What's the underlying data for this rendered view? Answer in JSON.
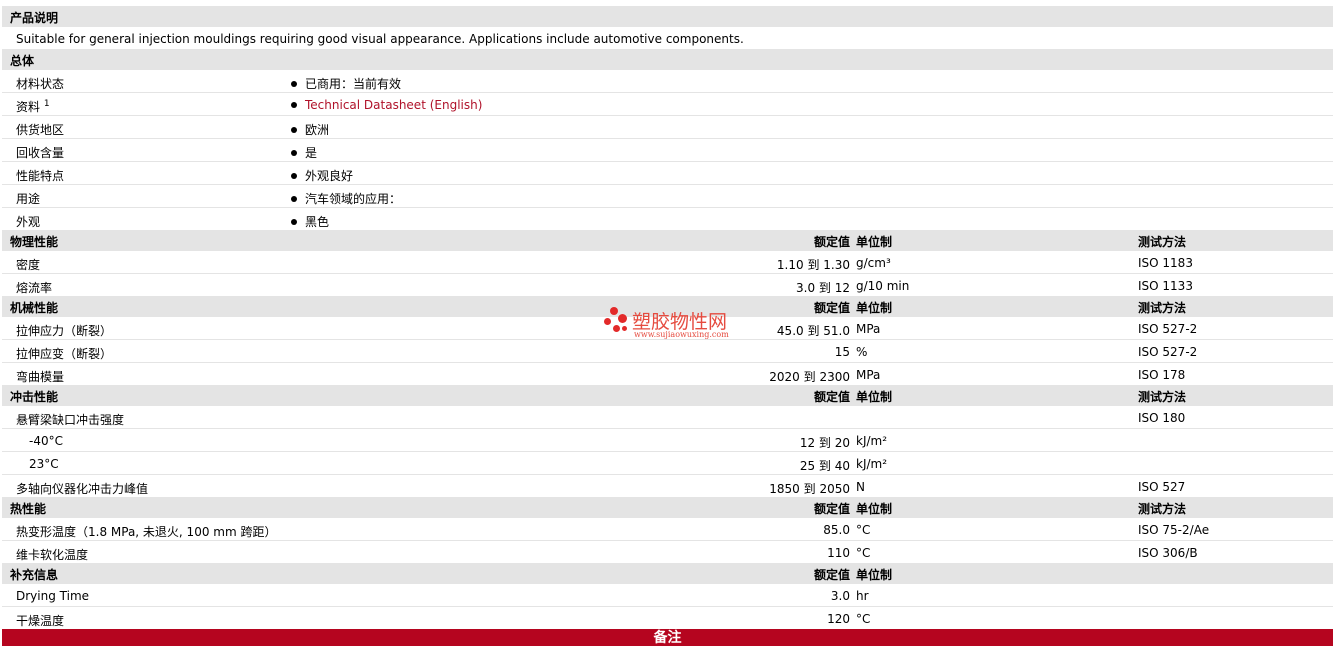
{
  "sections": {
    "product_desc": "产品说明",
    "description": "Suitable for general injection mouldings requiring good visual appearance. Applications include automotive components.",
    "general": "总体",
    "physical": "物理性能",
    "mechanical": "机械性能",
    "impact": "冲击性能",
    "thermal": "热性能",
    "supplementary": "补充信息"
  },
  "headers": {
    "nominal": "额定值",
    "unit": "单位制",
    "method": "测试方法"
  },
  "general": {
    "material_status": {
      "label": "材料状态",
      "value": "已商用：当前有效"
    },
    "datasheet": {
      "label": "资料",
      "sup": "1",
      "value": "Technical Datasheet (English)"
    },
    "region": {
      "label": "供货地区",
      "value": "欧洲"
    },
    "recycled": {
      "label": "回收含量",
      "value": "是"
    },
    "features": {
      "label": "性能特点",
      "value": "外观良好"
    },
    "uses": {
      "label": "用途",
      "value": "汽车领域的应用："
    },
    "appearance": {
      "label": "外观",
      "value": "黑色"
    }
  },
  "physical": {
    "density": {
      "label": "密度",
      "value": "1.10 到  1.30",
      "unit": "g/cm³",
      "method": "ISO 1183"
    },
    "mfr": {
      "label": "熔流率",
      "value": "3.0 到  12",
      "unit": "g/10 min",
      "method": "ISO 1133"
    }
  },
  "mechanical": {
    "tensile_stress": {
      "label": "拉伸应力（断裂）",
      "value": "45.0 到  51.0",
      "unit": "MPa",
      "method": "ISO 527-2"
    },
    "tensile_strain": {
      "label": "拉伸应变（断裂）",
      "value": "15",
      "unit": "%",
      "method": "ISO 527-2"
    },
    "flex_modulus": {
      "label": "弯曲模量",
      "value": "2020 到  2300",
      "unit": "MPa",
      "method": "ISO 178"
    }
  },
  "impact": {
    "izod": {
      "label": "悬臂梁缺口冲击强度",
      "method": "ISO 180"
    },
    "m40": {
      "label": "-40°C",
      "value": "12 到  20",
      "unit": "kJ/m²"
    },
    "p23": {
      "label": "23°C",
      "value": "25 到  40",
      "unit": "kJ/m²"
    },
    "multiaxial": {
      "label": "多轴向仪器化冲击力峰值",
      "value": "1850 到  2050",
      "unit": "N",
      "method": "ISO 527"
    }
  },
  "thermal": {
    "hdt": {
      "label": "热变形温度（1.8 MPa, 未退火, 100 mm 跨距）",
      "value": "85.0",
      "unit": "°C",
      "method": "ISO 75-2/Ae"
    },
    "vicat": {
      "label": "维卡软化温度",
      "value": "110",
      "unit": "°C",
      "method": "ISO 306/B"
    }
  },
  "supplementary": {
    "drying_time": {
      "label": "Drying Time",
      "value": "3.0",
      "unit": "hr"
    },
    "drying_temp": {
      "label": "干燥温度",
      "value": "120",
      "unit": "°C"
    }
  },
  "footer": "备注",
  "watermark": {
    "cn": "塑胶物性网",
    "en": "www.sujiaowuxing.com"
  },
  "colors": {
    "section_bg": "#e4e4e4",
    "footer_bg": "#b5051f",
    "link": "#b0122a",
    "watermark": "#e32a2a"
  }
}
